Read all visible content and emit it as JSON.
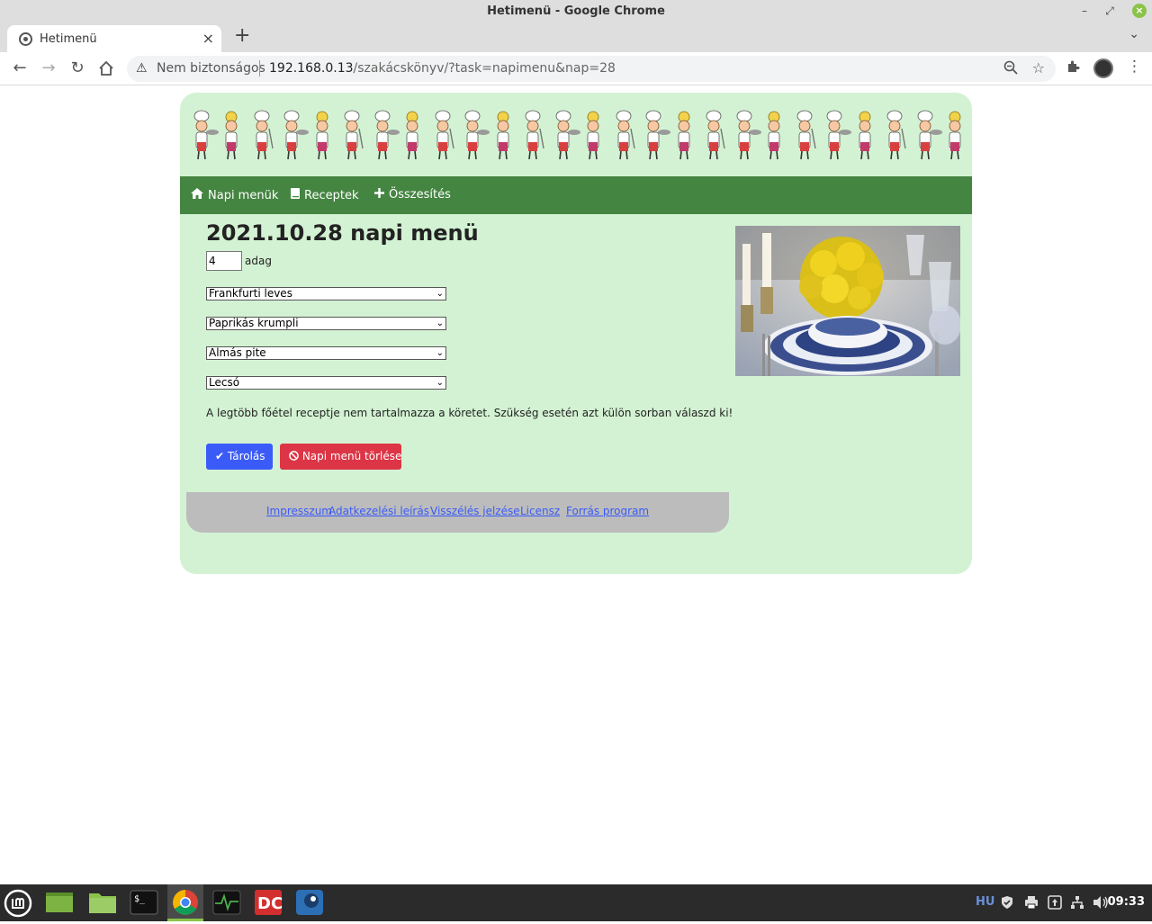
{
  "window": {
    "title": "Hetimenü - Google Chrome"
  },
  "tab": {
    "label": "Hetimenü"
  },
  "omnibox": {
    "security_label": "Nem biztonságos",
    "url_host": "192.168.0.13",
    "url_path": "/szakácskönyv/?task=napimenu&nap=28"
  },
  "nav": {
    "items": [
      {
        "label": "Napi menük",
        "icon": "home-icon"
      },
      {
        "label": "Receptek",
        "icon": "book-icon"
      },
      {
        "label": "Összesítés",
        "icon": "plus-icon"
      }
    ]
  },
  "main": {
    "heading": "2021.10.28 napi menü",
    "servings_value": "4",
    "servings_label": "adag",
    "selects": [
      {
        "value": "Frankfurti leves"
      },
      {
        "value": "Paprikás krumpli"
      },
      {
        "value": "Almás pite"
      },
      {
        "value": "Lecsó"
      }
    ],
    "note": "A legtöbb főétel receptje nem tartalmazza a köretet. Szükség esetén azt külön sorban válaszd ki!",
    "save_label": "Tárolás",
    "delete_label": "Napi menü törlése"
  },
  "footer": {
    "links": [
      "Impresszum",
      "Adatkezelési leírás",
      "Visszélés jelzése",
      "Licensz",
      "Forrás program"
    ]
  },
  "taskbar": {
    "tray_lang": "HU",
    "clock": "09:33"
  },
  "colors": {
    "page_bg": "#d3f2d3",
    "navbar": "#458542",
    "save_button": "#3a5bf7",
    "delete_button": "#dc3545",
    "footer_bg": "#bcbcbc"
  }
}
